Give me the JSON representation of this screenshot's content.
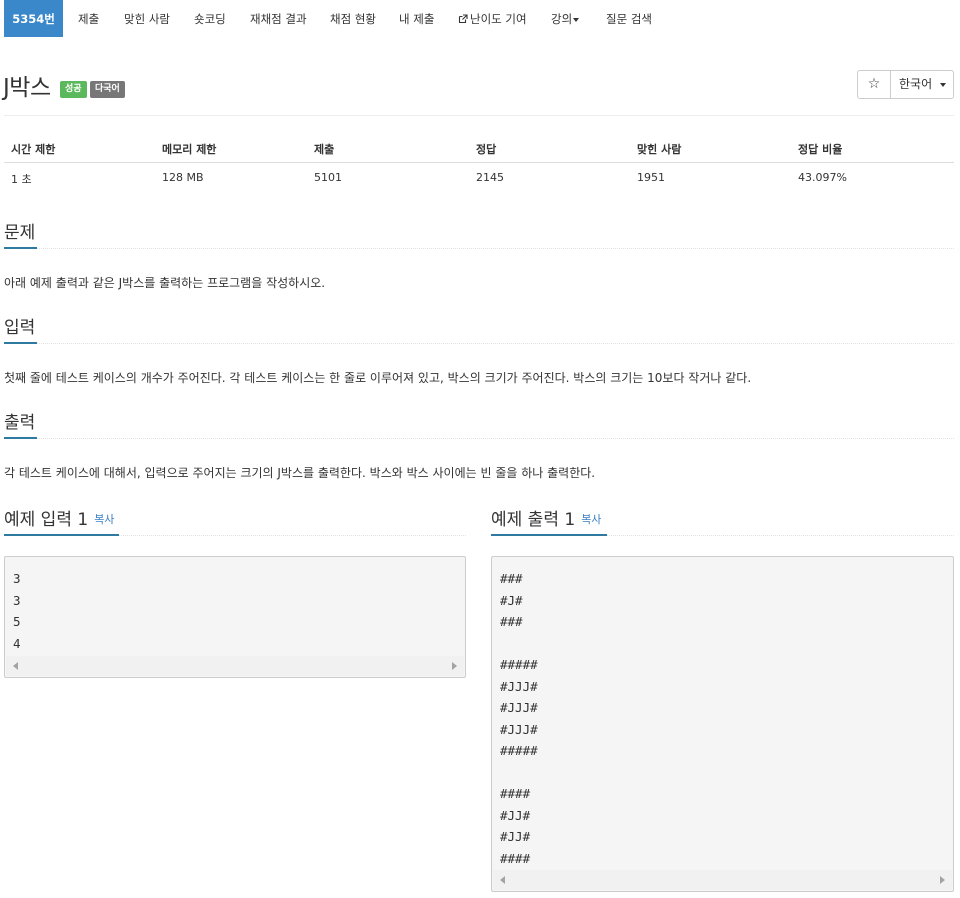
{
  "nav": {
    "problem_no": "5354번",
    "items": [
      "제출",
      "맞힌 사람",
      "숏코딩",
      "재채점 결과",
      "채점 현황",
      "내 제출",
      "난이도 기여",
      "강의",
      "질문 검색"
    ],
    "icons": {
      "contribute": "external-link-icon",
      "lecture_dropdown": "caret-down-icon"
    }
  },
  "problem": {
    "title": "J박스",
    "badges": [
      "성공",
      "다국어"
    ],
    "badge_colors": {
      "success": "#5cb85c",
      "multilang": "#777777"
    },
    "star_icon": "☆",
    "language": "한국어"
  },
  "stats": {
    "headers": [
      "시간 제한",
      "메모리 제한",
      "제출",
      "정답",
      "맞힌 사람",
      "정답 비율"
    ],
    "values": [
      "1 초",
      "128 MB",
      "5101",
      "2145",
      "1951",
      "43.097%"
    ]
  },
  "sections": {
    "description": {
      "title": "문제",
      "text": "아래 예제 출력과 같은 J박스를 출력하는 프로그램을 작성하시오."
    },
    "input": {
      "title": "입력",
      "text": "첫째 줄에 테스트 케이스의 개수가 주어진다. 각 테스트 케이스는 한 줄로 이루어져 있고, 박스의 크기가 주어진다. 박스의 크기는 10보다 작거나 같다."
    },
    "output": {
      "title": "출력",
      "text": "각 테스트 케이스에 대해서, 입력으로 주어지는 크기의 J박스를 출력한다. 박스와 박스 사이에는 빈 줄을 하나 출력한다."
    }
  },
  "samples": {
    "input": {
      "title": "예제 입력 1",
      "copy": "복사",
      "content": "3\n3\n5\n4"
    },
    "output": {
      "title": "예제 출력 1",
      "copy": "복사",
      "content": "###\n#J#\n###\n\n#####\n#JJJ#\n#JJJ#\n#JJJ#\n#####\n\n####\n#JJ#\n#JJ#\n####"
    }
  },
  "colors": {
    "accent": "#3a87c9",
    "section_underline": "#2f7aa0",
    "link": "#3b7fc4"
  }
}
